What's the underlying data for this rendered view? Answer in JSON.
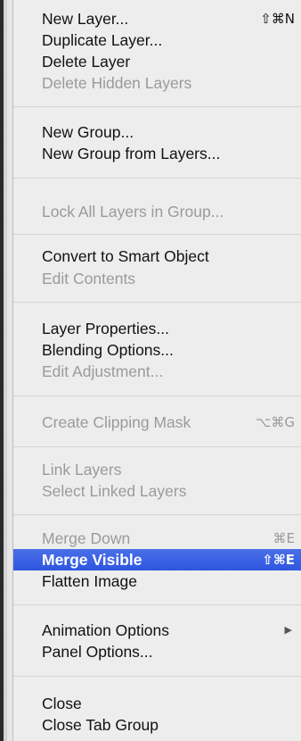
{
  "menu": {
    "items": [
      {
        "label": "New Layer...",
        "shortcut": "⇧⌘N",
        "enabled": true
      },
      {
        "label": "Duplicate Layer...",
        "shortcut": "",
        "enabled": true
      },
      {
        "label": "Delete Layer",
        "shortcut": "",
        "enabled": true
      },
      {
        "label": "Delete Hidden Layers",
        "shortcut": "",
        "enabled": false
      },
      {
        "label": "New Group...",
        "shortcut": "",
        "enabled": true
      },
      {
        "label": "New Group from Layers...",
        "shortcut": "",
        "enabled": true
      },
      {
        "label": "Lock All Layers in Group...",
        "shortcut": "",
        "enabled": false
      },
      {
        "label": "Convert to Smart Object",
        "shortcut": "",
        "enabled": true
      },
      {
        "label": "Edit Contents",
        "shortcut": "",
        "enabled": false
      },
      {
        "label": "Layer Properties...",
        "shortcut": "",
        "enabled": true
      },
      {
        "label": "Blending Options...",
        "shortcut": "",
        "enabled": true
      },
      {
        "label": "Edit Adjustment...",
        "shortcut": "",
        "enabled": false
      },
      {
        "label": "Create Clipping Mask",
        "shortcut": "⌥⌘G",
        "enabled": false
      },
      {
        "label": "Link Layers",
        "shortcut": "",
        "enabled": false
      },
      {
        "label": "Select Linked Layers",
        "shortcut": "",
        "enabled": false
      },
      {
        "label": "Merge Down",
        "shortcut": "⌘E",
        "enabled": false
      },
      {
        "label": "Merge Visible",
        "shortcut": "⇧⌘E",
        "enabled": true,
        "highlighted": true
      },
      {
        "label": "Flatten Image",
        "shortcut": "",
        "enabled": true
      },
      {
        "label": "Animation Options",
        "shortcut": "",
        "enabled": true,
        "submenu": true,
        "submenu_icon": "triangle-right-icon"
      },
      {
        "label": "Panel Options...",
        "shortcut": "",
        "enabled": true
      },
      {
        "label": "Close",
        "shortcut": "",
        "enabled": true
      },
      {
        "label": "Close Tab Group",
        "shortcut": "",
        "enabled": true
      }
    ],
    "highlight_color": "#3461e3",
    "disabled_color": "#9a9a9a"
  }
}
